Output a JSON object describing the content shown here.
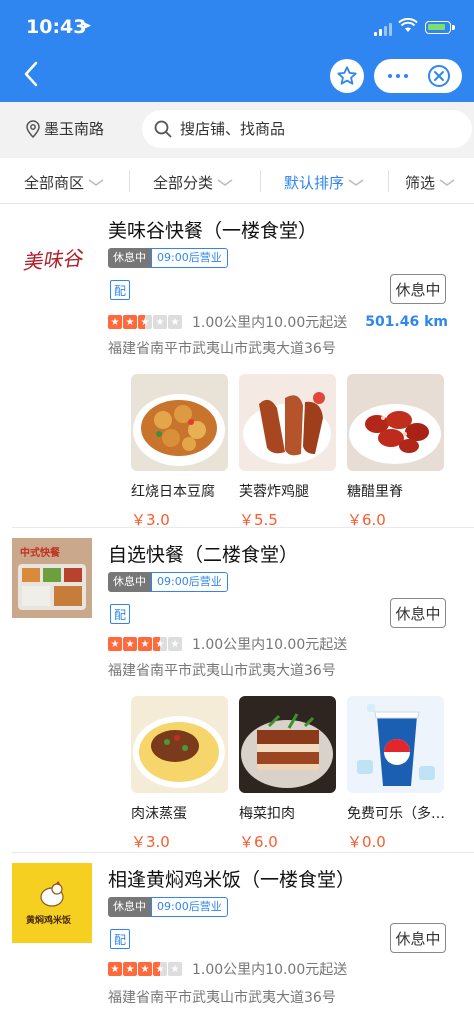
{
  "status": {
    "time": "10:43"
  },
  "search": {
    "location": "墨玉南路",
    "placeholder": "搜店铺、找商品"
  },
  "filters": [
    {
      "label": "全部商区",
      "active": false
    },
    {
      "label": "全部分类",
      "active": false
    },
    {
      "label": "默认排序",
      "active": true
    },
    {
      "label": "筛选",
      "active": false
    }
  ],
  "shops": [
    {
      "name": "美味谷快餐（一楼食堂）",
      "logo_text": "美味谷",
      "status": "休息中",
      "open_time": "09:00后营业",
      "delivery_tag": "配",
      "button": "休息中",
      "rating": 2.5,
      "delivery": "1.00公里内10.00元起送",
      "distance": "501.46 km",
      "address": "福建省南平市武夷山市武夷大道36号",
      "dishes": [
        {
          "name": "红烧日本豆腐",
          "price": "￥3.0"
        },
        {
          "name": "芙蓉炸鸡腿",
          "price": "￥5.5"
        },
        {
          "name": "糖醋里脊",
          "price": "￥6.0"
        }
      ]
    },
    {
      "name": "自选快餐（二楼食堂）",
      "logo_text": "中式快餐",
      "status": "休息中",
      "open_time": "09:00后营业",
      "delivery_tag": "配",
      "button": "休息中",
      "rating": 3.5,
      "delivery": "1.00公里内10.00元起送",
      "distance": "",
      "address": "福建省南平市武夷山市武夷大道36号",
      "dishes": [
        {
          "name": "肉沫蒸蛋",
          "price": "￥3.0"
        },
        {
          "name": "梅菜扣肉",
          "price": "￥6.0"
        },
        {
          "name": "免费可乐（多…",
          "price": "￥0.0"
        }
      ]
    },
    {
      "name": "相逢黄焖鸡米饭（一楼食堂）",
      "logo_text": "黄焖鸡米饭",
      "status": "休息中",
      "open_time": "09:00后营业",
      "delivery_tag": "配",
      "button": "休息中",
      "rating": 3.5,
      "delivery": "1.00公里内10.00元起送",
      "distance": "",
      "address": "福建省南平市武夷山市武夷大道36号"
    }
  ],
  "colors": {
    "brand": "#2f86f0",
    "price": "#ff5a2c",
    "star": "#ff6a3d"
  }
}
